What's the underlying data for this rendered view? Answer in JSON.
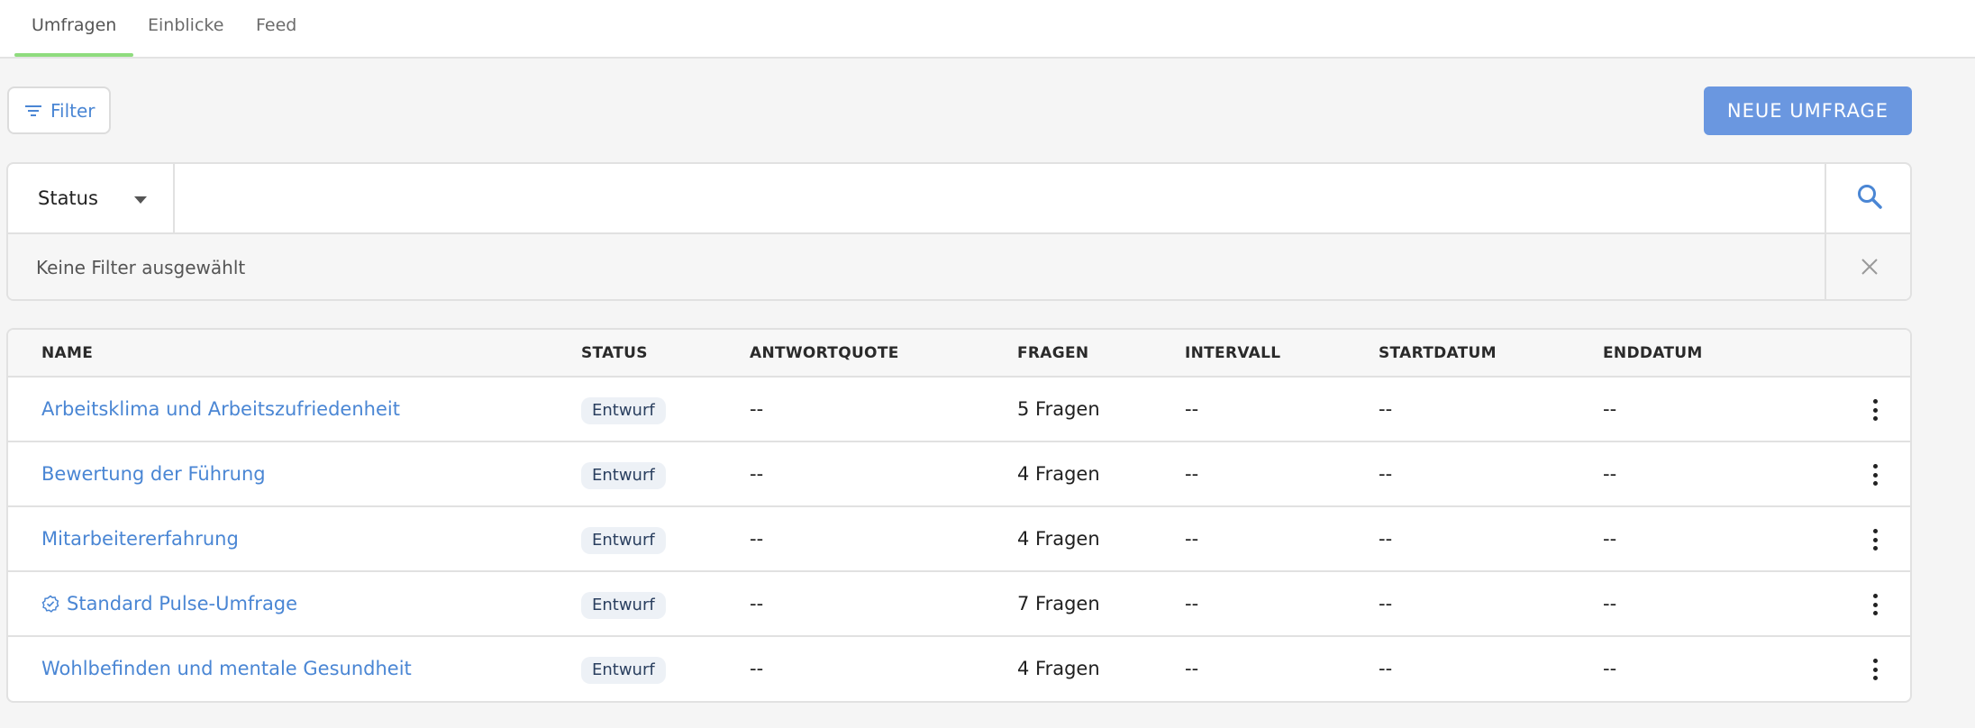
{
  "tabs": [
    {
      "label": "Umfragen",
      "active": true
    },
    {
      "label": "Einblicke",
      "active": false
    },
    {
      "label": "Feed",
      "active": false
    }
  ],
  "toolbar": {
    "filter_label": "Filter",
    "new_survey_label": "NEUE UMFRAGE"
  },
  "search": {
    "status_label": "Status",
    "placeholder": "",
    "no_filter_text": "Keine Filter ausgewählt"
  },
  "table": {
    "headers": [
      "NAME",
      "STATUS",
      "ANTWORTQUOTE",
      "FRAGEN",
      "INTERVALL",
      "STARTDATUM",
      "ENDDATUM"
    ],
    "rows": [
      {
        "name": "Arbeitsklima und Arbeitszufriedenheit",
        "status": "Entwurf",
        "quote": "--",
        "questions": "5 Fragen",
        "interval": "--",
        "start": "--",
        "end": "--",
        "icon": ""
      },
      {
        "name": "Bewertung der Führung",
        "status": "Entwurf",
        "quote": "--",
        "questions": "4 Fragen",
        "interval": "--",
        "start": "--",
        "end": "--",
        "icon": ""
      },
      {
        "name": "Mitarbeitererfahrung",
        "status": "Entwurf",
        "quote": "--",
        "questions": "4 Fragen",
        "interval": "--",
        "start": "--",
        "end": "--",
        "icon": ""
      },
      {
        "name": "Standard Pulse-Umfrage",
        "status": "Entwurf",
        "quote": "--",
        "questions": "7 Fragen",
        "interval": "--",
        "start": "--",
        "end": "--",
        "icon": "verified-badge-icon"
      },
      {
        "name": "Wohlbefinden und mentale Gesundheit",
        "status": "Entwurf",
        "quote": "--",
        "questions": "4 Fragen",
        "interval": "--",
        "start": "--",
        "end": "--",
        "icon": ""
      }
    ]
  },
  "colors": {
    "accent": "#4a86d4",
    "primary_button": "#6a97e0",
    "active_tab_underline": "#8fdc7e"
  }
}
